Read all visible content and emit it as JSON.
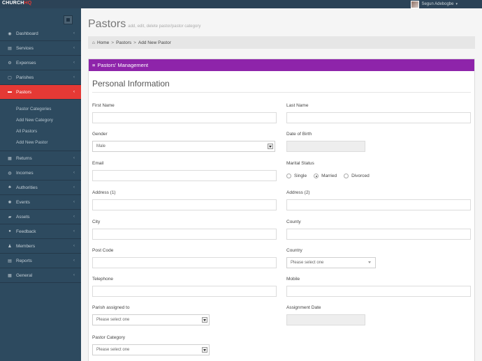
{
  "app": {
    "brand_main": "CHURCH",
    "brand_accent": "HQ",
    "user_name": "Segun Adebogbe"
  },
  "sidebar": {
    "items": [
      {
        "label": "Dashboard",
        "icon": "dashboard-icon",
        "glyph": "◉"
      },
      {
        "label": "Services",
        "icon": "services-icon",
        "glyph": "▤"
      },
      {
        "label": "Expenses",
        "icon": "expenses-icon",
        "glyph": "⚙"
      },
      {
        "label": "Parishes",
        "icon": "parishes-icon",
        "glyph": "▢"
      },
      {
        "label": "Pastors",
        "icon": "pastors-icon",
        "glyph": "▬"
      },
      {
        "label": "Returns",
        "icon": "returns-icon",
        "glyph": "▦"
      },
      {
        "label": "Incomes",
        "icon": "incomes-icon",
        "glyph": "◍"
      },
      {
        "label": "Authorities",
        "icon": "authorities-icon",
        "glyph": "♣"
      },
      {
        "label": "Events",
        "icon": "events-icon",
        "glyph": "✺"
      },
      {
        "label": "Assets",
        "icon": "assets-icon",
        "glyph": "▰"
      },
      {
        "label": "Feedback",
        "icon": "feedback-icon",
        "glyph": "●"
      },
      {
        "label": "Members",
        "icon": "members-icon",
        "glyph": "♟"
      },
      {
        "label": "Reports",
        "icon": "reports-icon",
        "glyph": "▤"
      },
      {
        "label": "General",
        "icon": "general-icon",
        "glyph": "▦"
      }
    ],
    "subitems": [
      "Pastor Categories",
      "Add New Category",
      "All Pastors",
      "Add New Pastor"
    ],
    "chevron": "‹"
  },
  "page": {
    "title": "Pastors",
    "subtitle": "add, edit, delete pastor/pastor category",
    "breadcrumb": [
      "Home",
      "Pastors",
      "Add New Pastor"
    ],
    "breadcrumb_sep": ">",
    "panel_title": "Pastors' Management",
    "section_title": "Personal Information"
  },
  "form": {
    "first_name": "First Name",
    "last_name": "Last Name",
    "gender": "Gender",
    "gender_value": "Male",
    "dob": "Date of Birth",
    "email": "Email",
    "marital_status": "Marital Status",
    "marital_options": [
      "Single",
      "Married",
      "Divorced"
    ],
    "marital_selected": "Married",
    "address1": "Address (1)",
    "address2": "Address (2)",
    "city": "City",
    "county": "County",
    "post_code": "Post Code",
    "country": "Country",
    "country_value": "Please select one",
    "telephone": "Telephone",
    "mobile": "Mobile",
    "parish": "Parish assigned to",
    "parish_value": "Please select one",
    "assignment_date": "Assignment Date",
    "pastor_category": "Pastor Category",
    "category_value": "Please select one"
  },
  "colors": {
    "sidebar": "#2d4a5f",
    "active": "#e53935",
    "panel_header": "#8e24aa"
  }
}
